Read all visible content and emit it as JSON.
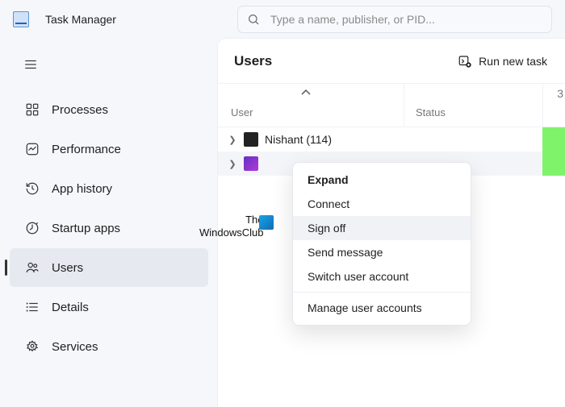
{
  "app": {
    "title": "Task Manager"
  },
  "search": {
    "placeholder": "Type a name, publisher, or PID..."
  },
  "sidebar": {
    "items": [
      {
        "label": "Processes"
      },
      {
        "label": "Performance"
      },
      {
        "label": "App history"
      },
      {
        "label": "Startup apps"
      },
      {
        "label": "Users"
      },
      {
        "label": "Details"
      },
      {
        "label": "Services"
      }
    ]
  },
  "main": {
    "title": "Users",
    "run_task_label": "Run new task",
    "columns": {
      "user": "User",
      "status": "Status"
    },
    "edge_value": "3",
    "rows": [
      {
        "name": "Nishant (114)"
      },
      {
        "name": ""
      }
    ]
  },
  "context_menu": {
    "items": [
      {
        "label": "Expand",
        "bold": true
      },
      {
        "label": "Connect"
      },
      {
        "label": "Sign off",
        "hovered": true
      },
      {
        "label": "Send message"
      },
      {
        "label": "Switch user account"
      }
    ],
    "separated": [
      {
        "label": "Manage user accounts"
      }
    ]
  },
  "watermark": {
    "line1": "The",
    "line2": "WindowsClub"
  }
}
